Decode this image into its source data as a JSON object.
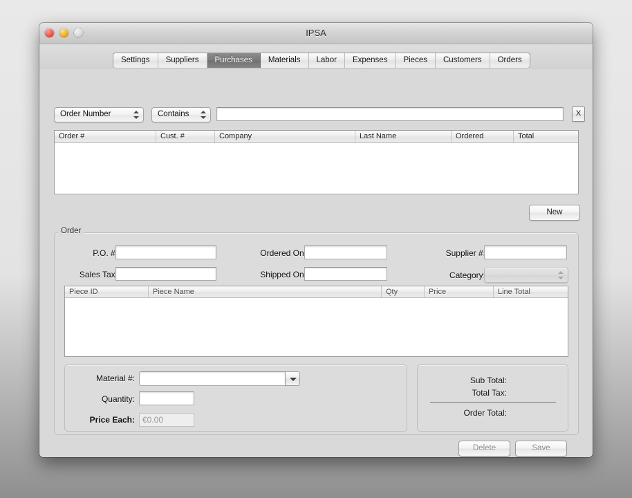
{
  "window": {
    "title": "IPSA",
    "controls": {
      "close": "close-button",
      "minimize": "minimize-button",
      "zoom": "zoom-button"
    }
  },
  "tabs": [
    {
      "label": "Settings",
      "selected": false
    },
    {
      "label": "Suppliers",
      "selected": false
    },
    {
      "label": "Purchases",
      "selected": true
    },
    {
      "label": "Materials",
      "selected": false
    },
    {
      "label": "Labor",
      "selected": false
    },
    {
      "label": "Expenses",
      "selected": false
    },
    {
      "label": "Pieces",
      "selected": false
    },
    {
      "label": "Customers",
      "selected": false
    },
    {
      "label": "Orders",
      "selected": false
    }
  ],
  "search": {
    "field_popup": "Order Number",
    "operator_popup": "Contains",
    "query_value": "",
    "query_placeholder": "",
    "clear_label": "X"
  },
  "orders_table": {
    "columns": [
      "Order #",
      "Cust. #",
      "Company",
      "Last Name",
      "Ordered",
      "Total"
    ],
    "rows": []
  },
  "buttons": {
    "new": "New",
    "delete": "Delete",
    "save": "Save"
  },
  "order_group": {
    "title": "Order",
    "fields": {
      "po_label": "P.O. #:",
      "po_value": "",
      "sales_tax_label": "Sales Tax:",
      "sales_tax_value": "",
      "ordered_on_label": "Ordered On:",
      "ordered_on_value": "",
      "shipped_on_label": "Shipped On:",
      "shipped_on_value": "",
      "supplier_label": "Supplier #:",
      "supplier_value": "",
      "category_label": "Category:",
      "category_value": ""
    }
  },
  "pieces_table": {
    "columns": [
      "Piece ID",
      "Piece Name",
      "Qty",
      "Price",
      "Line Total"
    ],
    "rows": []
  },
  "material_group": {
    "material_label": "Material #:",
    "material_value": "",
    "quantity_label": "Quantity:",
    "quantity_value": "",
    "price_each_label": "Price Each:",
    "price_each_value": "€0.00"
  },
  "totals_group": {
    "sub_total_label": "Sub Total:",
    "sub_total_value": "",
    "total_tax_label": "Total Tax:",
    "total_tax_value": "",
    "order_total_label": "Order Total:",
    "order_total_value": ""
  },
  "colors": {
    "window_background": "#d9d9d9",
    "selected_tab": "#797979",
    "field_background": "#ffffff",
    "group_background": "#dcdcdc"
  }
}
